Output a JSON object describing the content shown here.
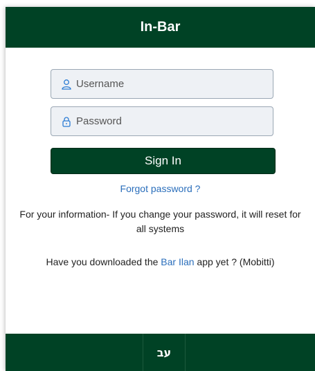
{
  "header": {
    "title": "In-Bar"
  },
  "login": {
    "username_placeholder": "Username",
    "password_placeholder": "Password",
    "signin_label": "Sign In",
    "forgot_label": "Forgot password ?"
  },
  "info": {
    "text": "For your information- If you change your password, it will reset for all systems"
  },
  "app": {
    "prefix": "Have you downloaded the ",
    "link": "Bar Ilan",
    "suffix": " app yet ? (Mobitti)"
  },
  "footer": {
    "language_label": "עב"
  },
  "icons": {
    "username": "user-icon",
    "password": "lock-icon"
  },
  "colors": {
    "primary": "#004225",
    "link": "#2a6ebb",
    "field_bg": "#eef1f5"
  }
}
